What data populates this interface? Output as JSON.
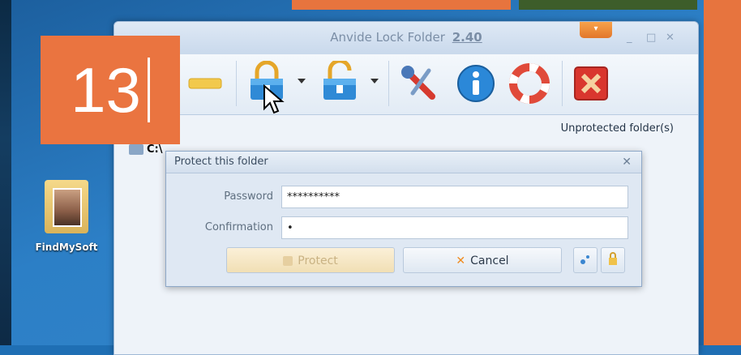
{
  "step_badge": {
    "number": "13"
  },
  "desktop": {
    "icon_label": "FindMySoft"
  },
  "window": {
    "title": "Anvide Lock Folder",
    "version": "2.40",
    "menu_glyph": "▾",
    "controls": {
      "minimize": "_",
      "maximize": "□",
      "close": "✕"
    }
  },
  "toolbar": {
    "items": [
      {
        "name": "add-folder",
        "icon": "minus-bar-icon"
      },
      {
        "name": "lock",
        "icon": "lock-icon"
      },
      {
        "name": "unlock",
        "icon": "unlock-icon"
      },
      {
        "name": "settings",
        "icon": "wrench-icon"
      },
      {
        "name": "about",
        "icon": "info-icon"
      },
      {
        "name": "help",
        "icon": "lifebuoy-icon"
      },
      {
        "name": "exit",
        "icon": "close-icon"
      }
    ]
  },
  "status_text": "Unprotected folder(s)",
  "path": "C:\\",
  "dialog": {
    "title": "Protect this folder",
    "close_glyph": "✕",
    "password_label": "Password",
    "password_value": "**********",
    "confirmation_label": "Confirmation",
    "confirmation_value": "•",
    "protect_label": "Protect",
    "cancel_label": "Cancel"
  },
  "colors": {
    "accent_orange": "#ea7440",
    "desktop_blue": "#2c7fc6",
    "window_bg": "#eef3f9"
  }
}
